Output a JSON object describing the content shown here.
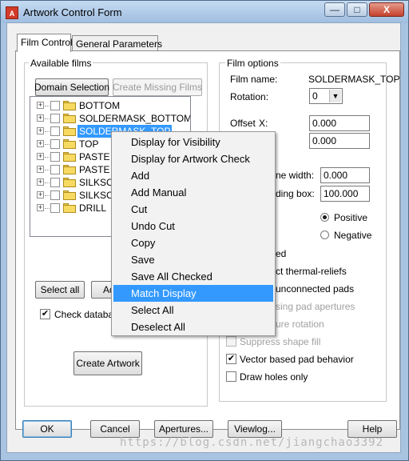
{
  "window": {
    "title": "Artwork Control Form",
    "icon_glyph": "A",
    "controls": {
      "minimize": "—",
      "maximize": "□",
      "close": "X"
    }
  },
  "tabs": [
    {
      "label": "Film Control",
      "active": true
    },
    {
      "label": "General Parameters",
      "active": false
    }
  ],
  "available_films": {
    "group_label": "Available films",
    "domain_selection_label": "Domain Selection",
    "create_missing_label": "Create Missing Films",
    "films": [
      {
        "label": "BOTTOM",
        "selected": false
      },
      {
        "label": "SOLDERMASK_BOTTOM",
        "selected": false
      },
      {
        "label": "SOLDERMASK_TOP",
        "selected": true
      },
      {
        "label": "TOP",
        "selected": false
      },
      {
        "label": "PASTE",
        "selected": false
      },
      {
        "label": "PASTE",
        "selected": false
      },
      {
        "label": "SILKSC",
        "selected": false
      },
      {
        "label": "SILKSC",
        "selected": false
      },
      {
        "label": "DRILL",
        "selected": false
      }
    ],
    "expander_glyph": "+",
    "select_all_label": "Select all",
    "add_label": "Ad",
    "check_database_label": "Check databas",
    "check_glyph": "✔",
    "create_artwork_label": "Create Artwork"
  },
  "context_menu": {
    "items": [
      {
        "label": "Display for Visibility",
        "highlighted": false
      },
      {
        "label": "Display for Artwork Check",
        "highlighted": false
      },
      {
        "label": "Add",
        "highlighted": false
      },
      {
        "label": "Add Manual",
        "highlighted": false
      },
      {
        "label": "Cut",
        "highlighted": false
      },
      {
        "label": "Undo Cut",
        "highlighted": false
      },
      {
        "label": "Copy",
        "highlighted": false
      },
      {
        "label": "Save",
        "highlighted": false
      },
      {
        "label": "Save All Checked",
        "highlighted": false
      },
      {
        "label": "Match Display",
        "highlighted": true
      },
      {
        "label": "Select All",
        "highlighted": false
      },
      {
        "label": "Deselect All",
        "highlighted": false
      }
    ]
  },
  "film_options": {
    "group_label": "Film options",
    "film_name_label": "Film name:",
    "film_name_value": "SOLDERMASK_TOP",
    "rotation_label": "Rotation:",
    "rotation_value": "0",
    "combo_arrow": "▼",
    "offset_label": "Offset",
    "offset_x_label": "X:",
    "offset_x_value": "0.000",
    "offset_y_value": "0.000",
    "line_width_label": "ne width:",
    "line_width_value": "0.000",
    "bounding_box_label": "ding box:",
    "bounding_box_value": "100.000",
    "positive_label": "Positive",
    "negative_label": "Negative",
    "positive_selected": true,
    "partial_checked_label": "ed",
    "thermal_reliefs_label": "ct thermal-reliefs",
    "unconnected_pads_label": "unconnected pads",
    "pad_apertures_label": "sing pad apertures",
    "aperture_rotation_label": "ure rotation",
    "suppress_shape_fill_label": "Suppress shape fill",
    "vector_based_label": "Vector based pad behavior",
    "vector_based_checked": true,
    "draw_holes_label": "Draw holes only",
    "draw_holes_checked": false
  },
  "bottom_buttons": {
    "ok": "OK",
    "cancel": "Cancel",
    "apertures": "Apertures...",
    "viewlog": "Viewlog...",
    "help": "Help"
  },
  "watermark": "https://blog.csdn.net/jiangchao3392"
}
